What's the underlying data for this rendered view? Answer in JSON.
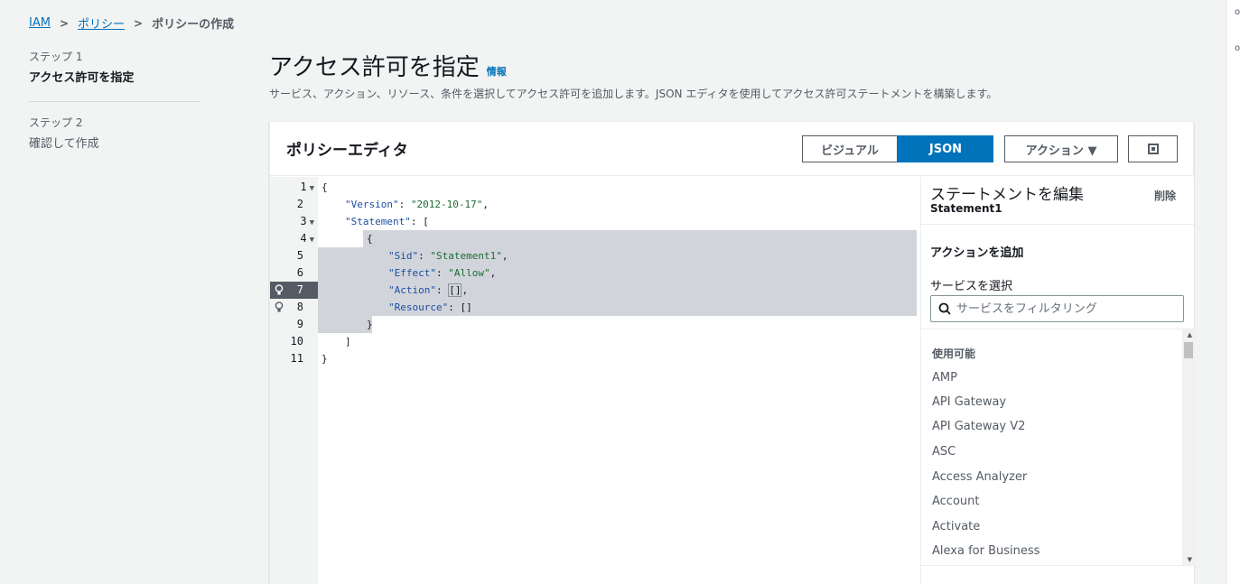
{
  "breadcrumb": {
    "items": [
      "IAM",
      "ポリシー"
    ],
    "current": "ポリシーの作成"
  },
  "steps": [
    {
      "label": "ステップ 1",
      "title": "アクセス許可を指定"
    },
    {
      "label": "ステップ 2",
      "title": "確認して作成"
    }
  ],
  "header": {
    "title": "アクセス許可を指定",
    "info": "情報",
    "description": "サービス、アクション、リソース、条件を選択してアクセス許可を追加します。JSON エディタを使用してアクセス許可ステートメントを構築します。"
  },
  "editor": {
    "title": "ポリシーエディタ",
    "modes": [
      "ビジュアル",
      "JSON"
    ],
    "active_mode": "JSON",
    "actions_label": "アクション ▼",
    "line_numbers": [
      "1",
      "2",
      "3",
      "4",
      "5",
      "6",
      "7",
      "8",
      "9",
      "10",
      "11"
    ],
    "code": {
      "l1": "{",
      "l2_key": "\"Version\"",
      "l2_val": "\"2012-10-17\"",
      "l3_key": "\"Statement\"",
      "l3_rest": ": [",
      "l4": "{",
      "l5_key": "\"Sid\"",
      "l5_val": "\"Statement1\"",
      "l6_key": "\"Effect\"",
      "l6_val": "\"Allow\"",
      "l7_key": "\"Action\"",
      "l7_val": "[]",
      "l8_key": "\"Resource\"",
      "l8_val": "[]",
      "l9": "}",
      "l10": "]",
      "l11": "}"
    }
  },
  "panel": {
    "title": "ステートメントを編集",
    "subtitle": "Statement1",
    "delete_label": "削除",
    "add_action_label": "アクションを追加",
    "service_label": "サービスを選択",
    "search_placeholder": "サービスをフィルタリング",
    "group_label": "使用可能",
    "services": [
      "AMP",
      "API Gateway",
      "API Gateway V2",
      "ASC",
      "Access Analyzer",
      "Account",
      "Activate",
      "Alexa for Business"
    ]
  }
}
